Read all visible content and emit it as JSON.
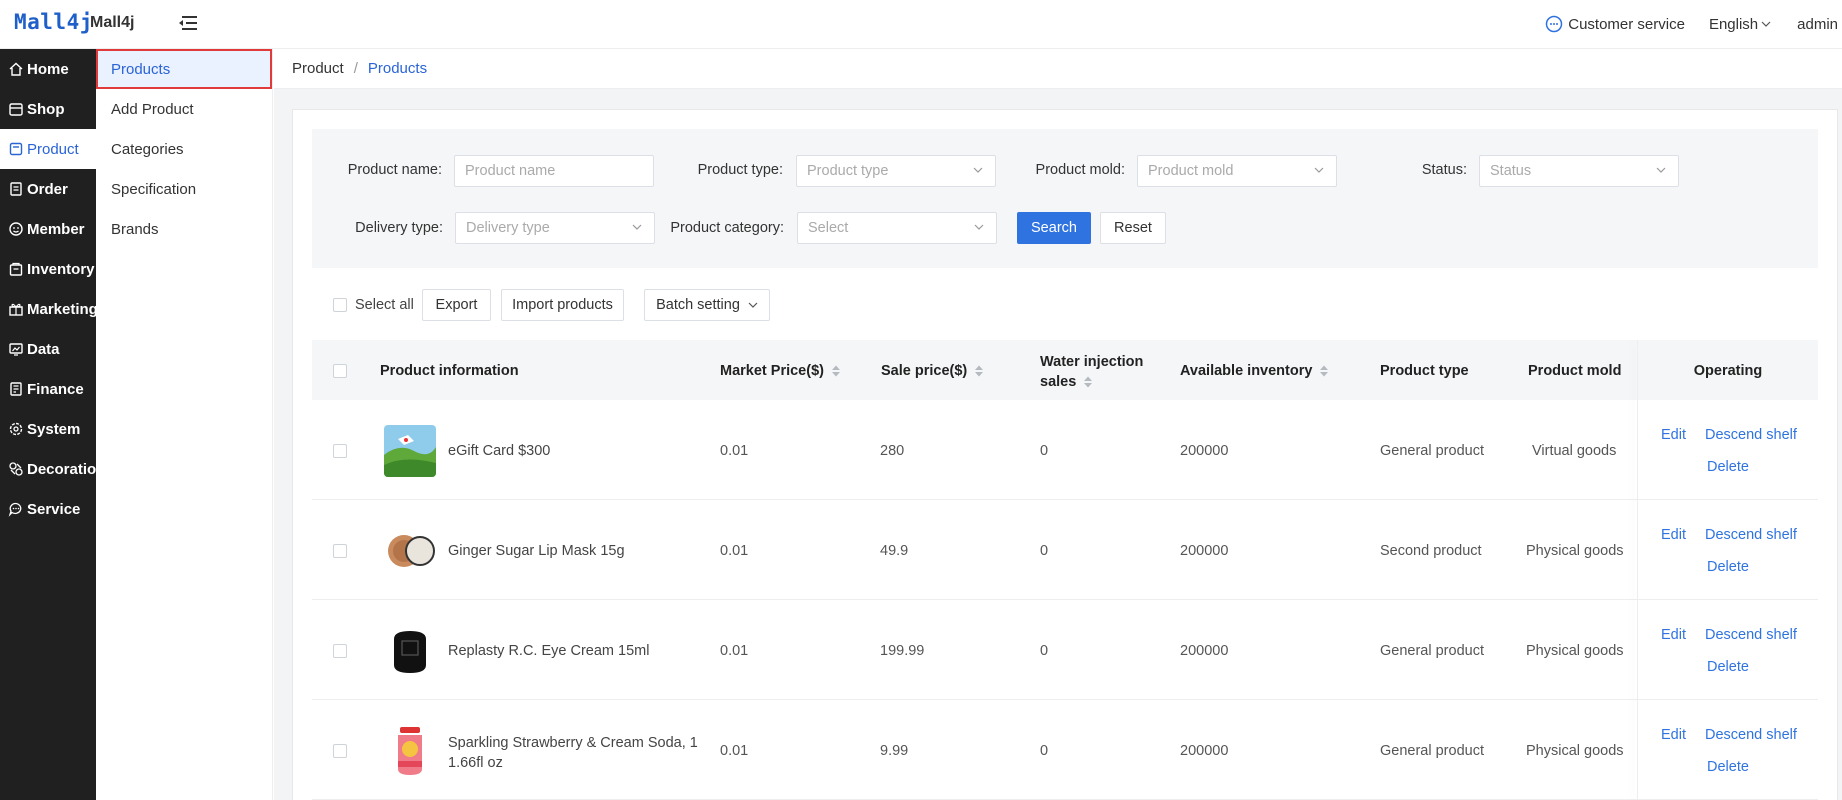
{
  "header": {
    "logo_text_a": "Mall4j",
    "app_name": "Mall4j",
    "customer_service": "Customer service",
    "language": "English",
    "user": "admin"
  },
  "sidebar": {
    "items": [
      {
        "label": "Home",
        "icon": "home-icon"
      },
      {
        "label": "Shop",
        "icon": "shop-icon"
      },
      {
        "label": "Product",
        "icon": "product-icon"
      },
      {
        "label": "Order",
        "icon": "order-icon"
      },
      {
        "label": "Member",
        "icon": "member-icon"
      },
      {
        "label": "Inventory",
        "icon": "inventory-icon"
      },
      {
        "label": "Marketing",
        "icon": "marketing-icon"
      },
      {
        "label": "Data",
        "icon": "data-icon"
      },
      {
        "label": "Finance",
        "icon": "finance-icon"
      },
      {
        "label": "System",
        "icon": "system-icon"
      },
      {
        "label": "Decoration",
        "icon": "decoration-icon"
      },
      {
        "label": "Service",
        "icon": "service-icon"
      }
    ]
  },
  "subnav": {
    "items": [
      "Products",
      "Add Product",
      "Categories",
      "Specification",
      "Brands"
    ]
  },
  "breadcrumb": {
    "parent": "Product",
    "separator": "/",
    "current": "Products"
  },
  "filters": {
    "product_name_label": "Product name:",
    "product_name_placeholder": "Product name",
    "product_type_label": "Product type:",
    "product_type_placeholder": "Product type",
    "product_mold_label": "Product mold:",
    "product_mold_placeholder": "Product mold",
    "status_label": "Status:",
    "status_placeholder": "Status",
    "delivery_type_label": "Delivery type:",
    "delivery_type_placeholder": "Delivery type",
    "category_label": "Product category:",
    "category_placeholder": "Select",
    "search_button": "Search",
    "reset_button": "Reset"
  },
  "toolbar": {
    "select_all": "Select all",
    "export": "Export",
    "import": "Import products",
    "batch": "Batch setting"
  },
  "table": {
    "columns": {
      "info": "Product information",
      "market_price": "Market Price($)",
      "sale_price": "Sale price($)",
      "water_line1": "Water injection",
      "water_line2": "sales",
      "inventory": "Available inventory",
      "type": "Product type",
      "mold": "Product mold",
      "operating": "Operating"
    },
    "rows": [
      {
        "name": "eGift Card $300",
        "name2": "",
        "market_price": "0.01",
        "sale_price": "280",
        "water": "0",
        "inventory": "200000",
        "type": "General product",
        "mold": "Virtual goods",
        "edit": "Edit",
        "descend": "Descend shelf",
        "delete": "Delete"
      },
      {
        "name": "Ginger Sugar Lip Mask 15g",
        "name2": "",
        "market_price": "0.01",
        "sale_price": "49.9",
        "water": "0",
        "inventory": "200000",
        "type": "Second product",
        "mold": "Physical goods",
        "edit": "Edit",
        "descend": "Descend shelf",
        "delete": "Delete"
      },
      {
        "name": "Replasty R.C. Eye Cream 15ml",
        "name2": "",
        "market_price": "0.01",
        "sale_price": "199.99",
        "water": "0",
        "inventory": "200000",
        "type": "General product",
        "mold": "Physical goods",
        "edit": "Edit",
        "descend": "Descend shelf",
        "delete": "Delete"
      },
      {
        "name": "Sparkling Strawberry & Cream Soda, 1",
        "name2": "1.66fl oz",
        "market_price": "0.01",
        "sale_price": "9.99",
        "water": "0",
        "inventory": "200000",
        "type": "General product",
        "mold": "Physical goods",
        "edit": "Edit",
        "descend": "Descend shelf",
        "delete": "Delete"
      }
    ]
  },
  "colors": {
    "accent": "#2f73e0",
    "sidebar_bg": "#202020",
    "highlight_border": "#e03a3a"
  }
}
